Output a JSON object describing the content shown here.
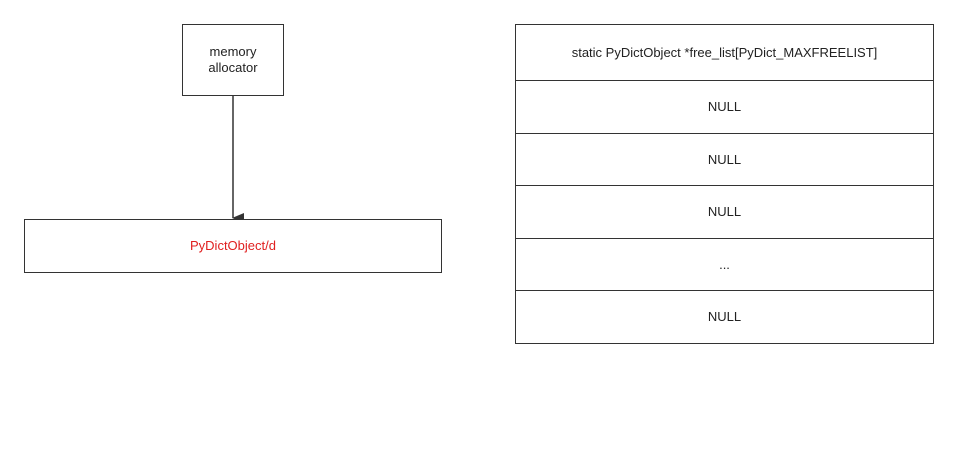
{
  "allocator": {
    "label": "memory\nallocator"
  },
  "dict_object": {
    "label": "PyDictObject/d",
    "color": "#e02020"
  },
  "free_list": {
    "header": "static PyDictObject *free_list[PyDict_MAXFREELIST]",
    "slots": [
      "NULL",
      "NULL",
      "NULL",
      "...",
      "NULL"
    ]
  }
}
